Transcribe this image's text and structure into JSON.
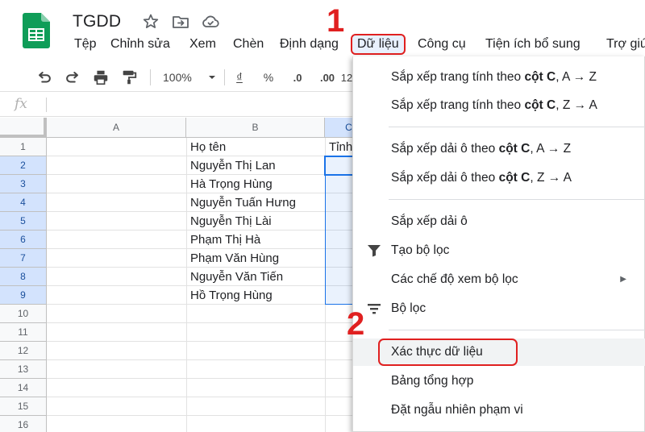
{
  "app": {
    "title": "TGDD"
  },
  "menu": [
    {
      "label": "Tệp"
    },
    {
      "label": "Chỉnh sửa"
    },
    {
      "label": "Xem"
    },
    {
      "label": "Chèn"
    },
    {
      "label": "Định dạng"
    },
    {
      "label": "Dữ liệu"
    },
    {
      "label": "Công cụ"
    },
    {
      "label": "Tiện ích bổ sung"
    },
    {
      "label": "Trợ giú"
    }
  ],
  "toolbar": {
    "zoom": "100%",
    "currency": "₫",
    "percent": "%",
    "dec_less": ".0",
    "dec_more": ".00",
    "more_formats": "12"
  },
  "formula_bar": {
    "fx": "fx"
  },
  "grid": {
    "columns": [
      "A",
      "B",
      "C"
    ],
    "rows": [
      "1",
      "2",
      "3",
      "4",
      "5",
      "6",
      "7",
      "8",
      "9",
      "10",
      "11",
      "12",
      "13",
      "14",
      "15",
      "16"
    ],
    "cells_b": [
      "Họ tên",
      "Nguyễn Thị Lan",
      "Hà Trọng Hùng",
      "Nguyễn Tuấn Hưng",
      "Nguyễn Thị Lài",
      "Phạm Thị Hà",
      "Phạm Văn Hùng",
      "Nguyễn Văn Tiến",
      "Hồ Trọng Hùng"
    ],
    "cell_c1": "Tỉnh"
  },
  "dropdown": {
    "sort_sheet_az": {
      "prefix": "Sắp xếp trang tính theo ",
      "bold": "cột C",
      "suffix": ", A → Z"
    },
    "sort_sheet_za": {
      "prefix": "Sắp xếp trang tính theo ",
      "bold": "cột C",
      "suffix": ", Z → A"
    },
    "sort_range_az": {
      "prefix": "Sắp xếp dải ô theo ",
      "bold": "cột C",
      "suffix": ", A → Z"
    },
    "sort_range_za": {
      "prefix": "Sắp xếp dải ô theo ",
      "bold": "cột C",
      "suffix": ", Z → A"
    },
    "sort_range": "Sắp xếp dải ô",
    "create_filter": "Tạo bộ lọc",
    "filter_views": "Các chế độ xem bộ lọc",
    "slicer": "Bộ lọc",
    "data_validation": "Xác thực dữ liệu",
    "pivot_table": "Bảng tổng hợp",
    "randomize_range": "Đặt ngẫu nhiên phạm vi"
  },
  "annotations": {
    "step1": "1",
    "step2": "2"
  },
  "colors": {
    "sheets_green": "#0f9d58",
    "highlight_red": "#e02020",
    "selection_blue": "#1a73e8"
  },
  "icons": [
    "sheets-logo",
    "star-icon",
    "move-to-folder-icon",
    "cloud-saved-icon",
    "undo-icon",
    "redo-icon",
    "print-icon",
    "paint-format-icon",
    "zoom-dropdown-icon",
    "filter-icon",
    "slicer-icon",
    "submenu-arrow-icon"
  ]
}
